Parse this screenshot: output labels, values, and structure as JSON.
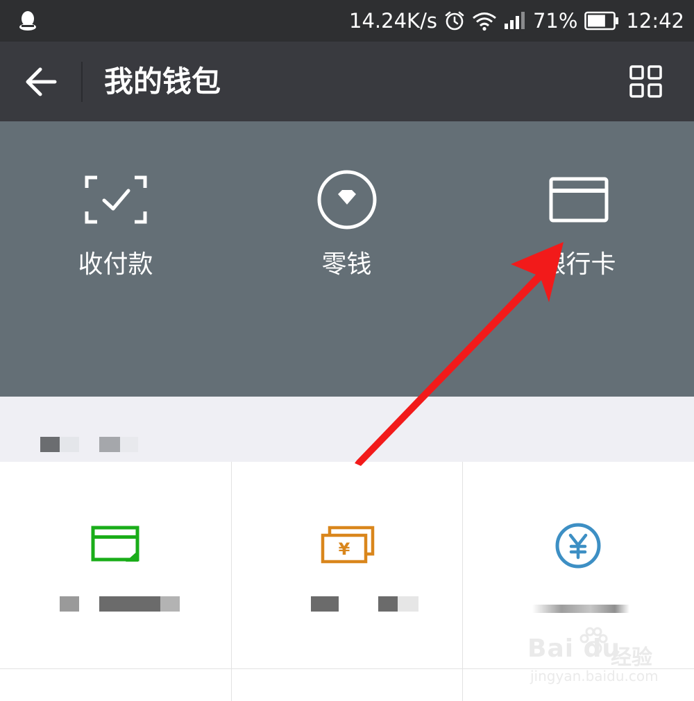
{
  "status_bar": {
    "network_speed": "14.24K/s",
    "battery_percent": "71%",
    "battery_level": 0.71,
    "time": "12:42",
    "icons": [
      "qq-icon",
      "alarm-icon",
      "wifi-icon",
      "signal-icon",
      "battery-icon"
    ]
  },
  "header": {
    "title": "我的钱包",
    "back_icon": "back-arrow-icon",
    "more_icon": "grid-menu-icon"
  },
  "top_panel": {
    "items": [
      {
        "label": "收付款",
        "icon": "scan-check-icon"
      },
      {
        "label": "零钱",
        "icon": "diamond-coin-icon"
      },
      {
        "label": "银行卡",
        "icon": "bank-card-icon"
      }
    ]
  },
  "services": {
    "items": [
      {
        "icon": "green-card-icon",
        "color": "#1aad19"
      },
      {
        "icon": "yuan-notes-icon",
        "color": "#d9861c"
      },
      {
        "icon": "yuan-circle-icon",
        "color": "#3d8fc4"
      }
    ]
  },
  "watermark": {
    "brand": "Bai du",
    "brand_cn": "经验",
    "url": "jingyan.baidu.com"
  },
  "colors": {
    "status_bar": "#2e2f31",
    "header": "#393a3f",
    "panel": "#646f76",
    "section_bg": "#efeff4",
    "arrow": "#f21a1a"
  }
}
